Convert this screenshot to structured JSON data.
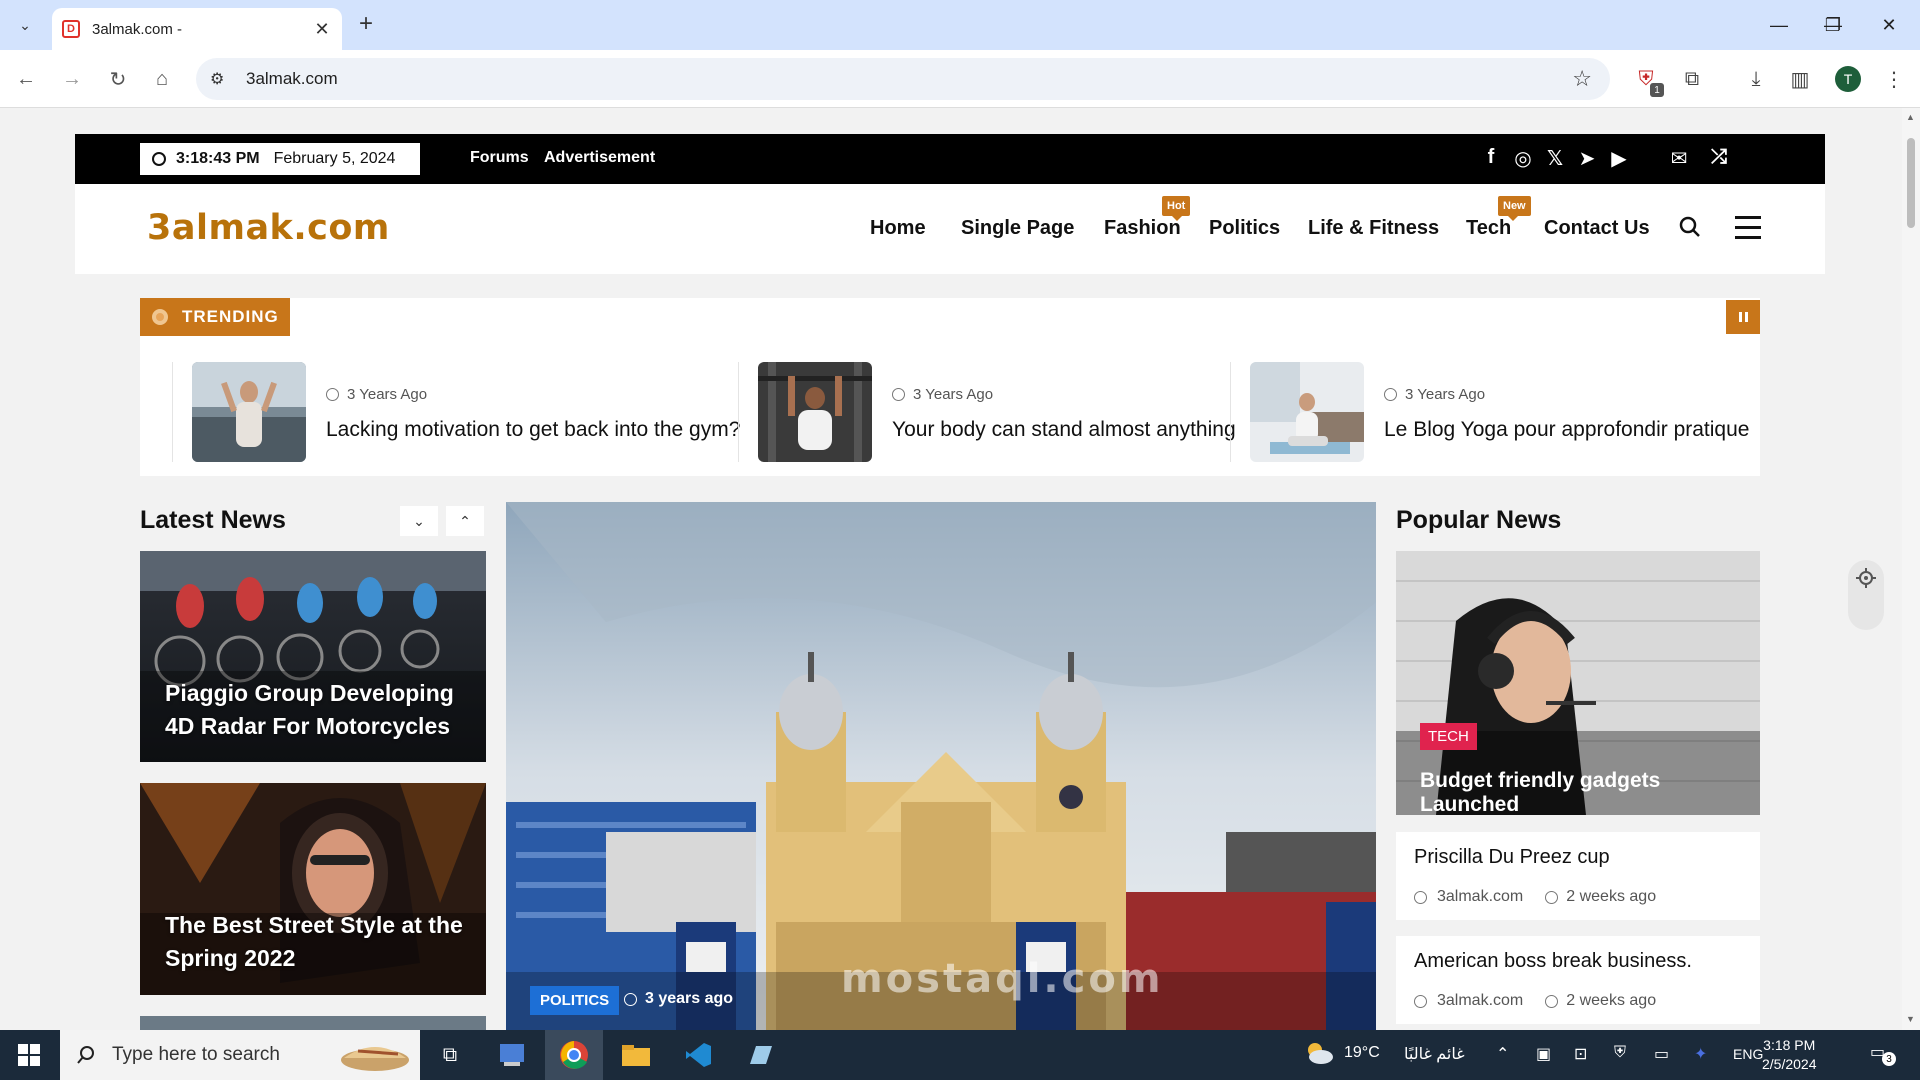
{
  "browser": {
    "tab_title": "3almak.com -",
    "url": "3almak.com",
    "profile_initial": "T",
    "extension_badge": "1"
  },
  "topbar": {
    "time": "3:18:43 PM",
    "date": "February 5, 2024",
    "links": [
      "Forums",
      "Advertisement"
    ]
  },
  "header": {
    "logo": "3almak.com",
    "menu": [
      {
        "label": "Home"
      },
      {
        "label": "Single Page"
      },
      {
        "label": "Fashion",
        "badge": "Hot"
      },
      {
        "label": "Politics"
      },
      {
        "label": "Life & Fitness"
      },
      {
        "label": "Tech",
        "badge": "New"
      },
      {
        "label": "Contact Us"
      }
    ]
  },
  "trending": {
    "label": "TRENDING",
    "items": [
      {
        "time": "3 Years Ago",
        "title": "Lacking motivation to get back into the gym?"
      },
      {
        "time": "3 Years Ago",
        "title": "Your body can stand almost anything"
      },
      {
        "time": "3 Years Ago",
        "title": "Le Blog Yoga pour approfondir pratique"
      }
    ]
  },
  "latest": {
    "title": "Latest News",
    "cards": [
      {
        "title_line1": "Piaggio Group Developing",
        "title_line2": "4D Radar For Motorcycles"
      },
      {
        "title_line1": "The Best Street Style at the",
        "title_line2": "Spring 2022"
      }
    ]
  },
  "hero": {
    "category": "POLITICS",
    "time": "3 years ago",
    "watermark": "mostaql.com"
  },
  "popular": {
    "title": "Popular News",
    "main": {
      "category": "TECH",
      "title": "Budget friendly gadgets Launched"
    },
    "items": [
      {
        "title": "Priscilla Du Preez cup",
        "author": "3almak.com",
        "time": "2 weeks ago"
      },
      {
        "title": "American boss break business.",
        "author": "3almak.com",
        "time": "2 weeks ago"
      }
    ]
  },
  "taskbar": {
    "search_placeholder": "Type here to search",
    "weather": "19°C",
    "weather_text": "غائم غالبًا",
    "lang": "ENG",
    "time": "3:18 PM",
    "date": "2/5/2024",
    "notification_count": "3"
  }
}
